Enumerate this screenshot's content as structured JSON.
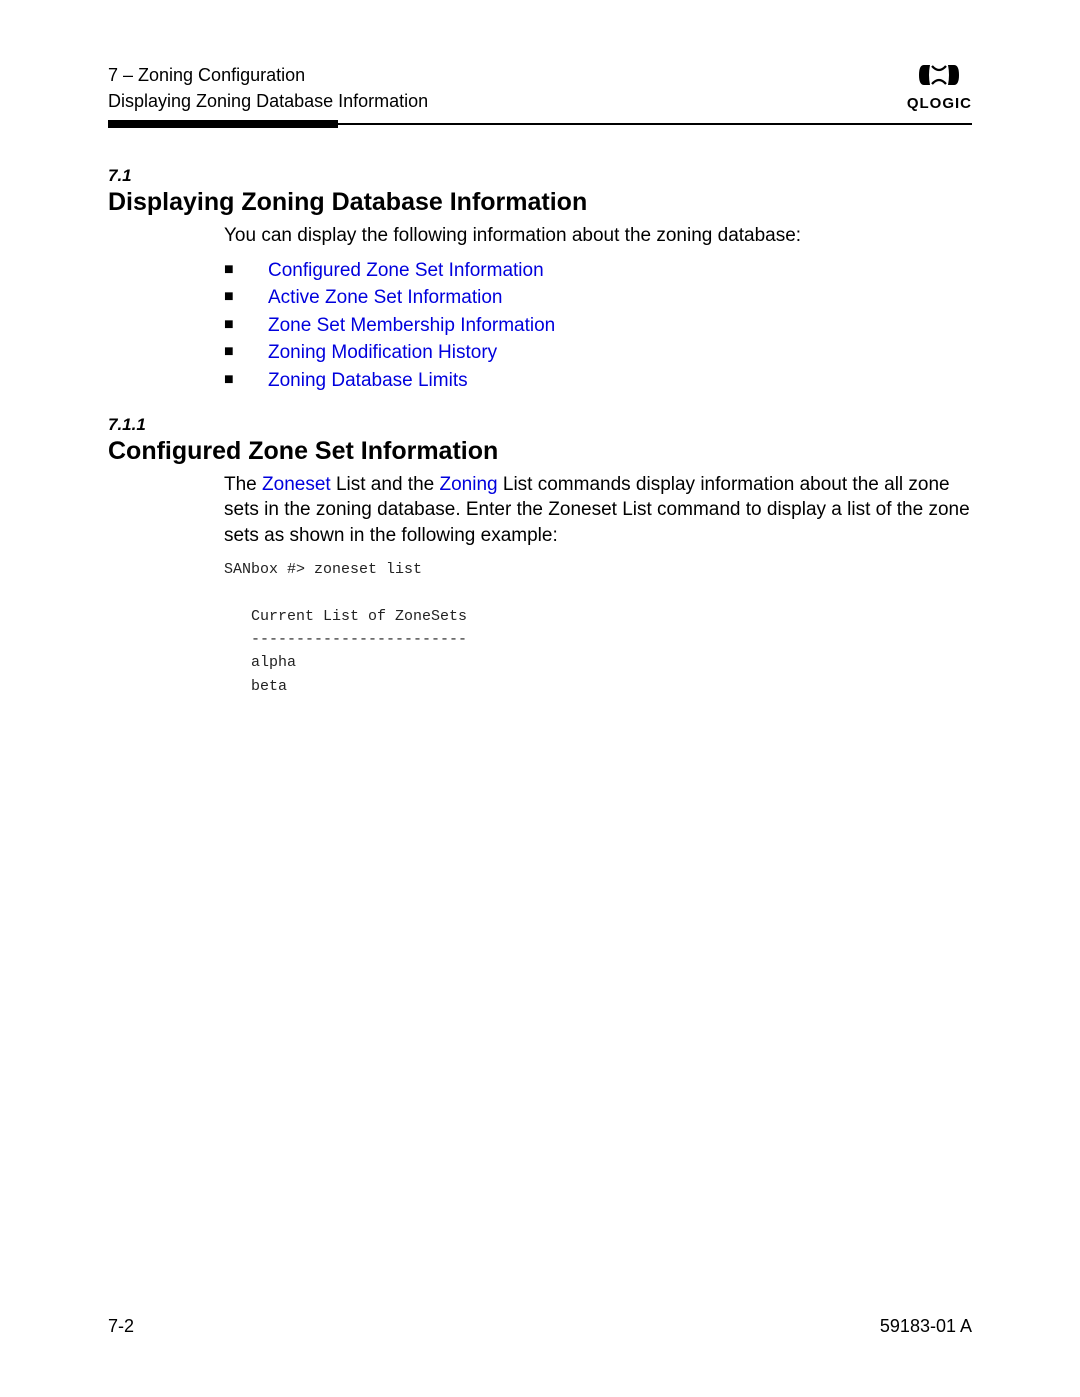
{
  "header": {
    "chapter_line": "7 – Zoning Configuration",
    "subtitle": "Displaying Zoning Database Information",
    "logo_text": "QLOGIC"
  },
  "section1": {
    "num": "7.1",
    "title": "Displaying Zoning Database Information",
    "intro": "You can display the following information about the zoning database:",
    "bullets": [
      "Configured Zone Set Information",
      "Active Zone Set Information",
      "Zone Set Membership Information",
      "Zoning Modification History",
      "Zoning Database Limits"
    ]
  },
  "section2": {
    "num": "7.1.1",
    "title": "Configured Zone Set Information",
    "para_pre": "The ",
    "link1": "Zoneset",
    "para_mid1": " List and the ",
    "link2": "Zoning",
    "para_post": " List commands display information about the all zone sets in the zoning database. Enter the Zoneset List command to display a list of the zone sets as shown in the following example:",
    "code": "SANbox #> zoneset list\n\n   Current List of ZoneSets\n   ------------------------\n   alpha\n   beta"
  },
  "footer": {
    "left": "7-2",
    "right": "59183-01 A"
  }
}
